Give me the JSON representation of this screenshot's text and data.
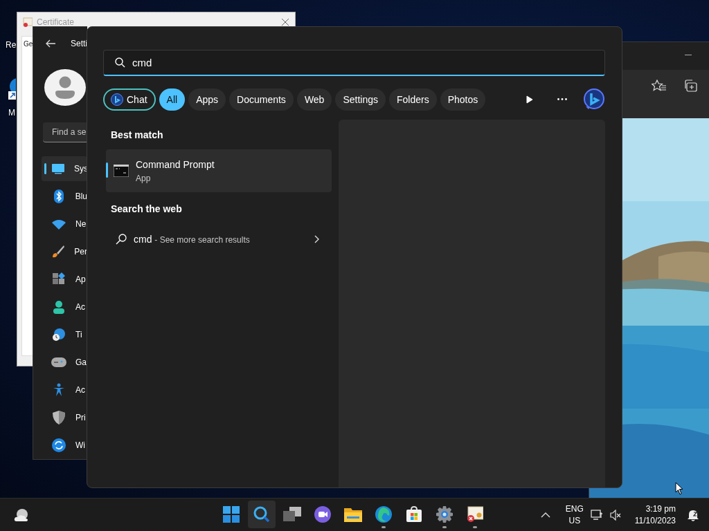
{
  "desktop": {
    "icons": [
      {
        "label": "Re"
      },
      {
        "label": "M"
      }
    ]
  },
  "certificate_window": {
    "title": "Certificate",
    "tab": "Ge"
  },
  "settings_window": {
    "title": "Setti",
    "search": {
      "placeholder": "Find a se"
    },
    "nav_items": [
      {
        "kind": "system",
        "label": "Sys",
        "selected": true
      },
      {
        "kind": "bluetooth",
        "label": "Blu",
        "selected": false
      },
      {
        "kind": "network",
        "label": "Ne",
        "selected": false
      },
      {
        "kind": "personalization",
        "label": "Per",
        "selected": false
      },
      {
        "kind": "apps",
        "label": "Ap",
        "selected": false
      },
      {
        "kind": "accounts",
        "label": "Ac",
        "selected": false
      },
      {
        "kind": "time",
        "label": "Ti",
        "selected": false
      },
      {
        "kind": "gaming",
        "label": "Ga",
        "selected": false
      },
      {
        "kind": "accessibility",
        "label": "Ac",
        "selected": false
      },
      {
        "kind": "privacy",
        "label": "Pri",
        "selected": false
      },
      {
        "kind": "update",
        "label": "Wi",
        "selected": false
      }
    ]
  },
  "search_panel": {
    "query": "cmd",
    "filters": [
      {
        "kind": "chat",
        "label": "Chat",
        "selected": false
      },
      {
        "kind": "scope",
        "label": "All",
        "selected": true
      },
      {
        "kind": "scope",
        "label": "Apps",
        "selected": false
      },
      {
        "kind": "scope",
        "label": "Documents",
        "selected": false
      },
      {
        "kind": "scope",
        "label": "Web",
        "selected": false
      },
      {
        "kind": "scope",
        "label": "Settings",
        "selected": false
      },
      {
        "kind": "scope",
        "label": "Folders",
        "selected": false
      },
      {
        "kind": "scope",
        "label": "Photos",
        "selected": false
      }
    ],
    "best_match": {
      "heading": "Best match",
      "title": "Command Prompt",
      "subtitle": "App",
      "selected": true
    },
    "web_search": {
      "heading": "Search the web",
      "query": "cmd",
      "hint": "- See more search results"
    }
  },
  "taskbar": {
    "apps": [
      {
        "kind": "start",
        "active": false,
        "running": false
      },
      {
        "kind": "search",
        "active": true,
        "running": false
      },
      {
        "kind": "task_view",
        "active": false,
        "running": false
      },
      {
        "kind": "chat",
        "active": false,
        "running": false
      },
      {
        "kind": "explorer",
        "active": false,
        "running": false
      },
      {
        "kind": "edge",
        "active": false,
        "running": true
      },
      {
        "kind": "store",
        "active": false,
        "running": false
      },
      {
        "kind": "settings",
        "active": false,
        "running": true
      },
      {
        "kind": "certificate",
        "active": false,
        "running": true
      }
    ],
    "tray": {
      "language": "ENG",
      "region": "US",
      "time": "3:19 pm",
      "date": "11/10/2023"
    }
  }
}
